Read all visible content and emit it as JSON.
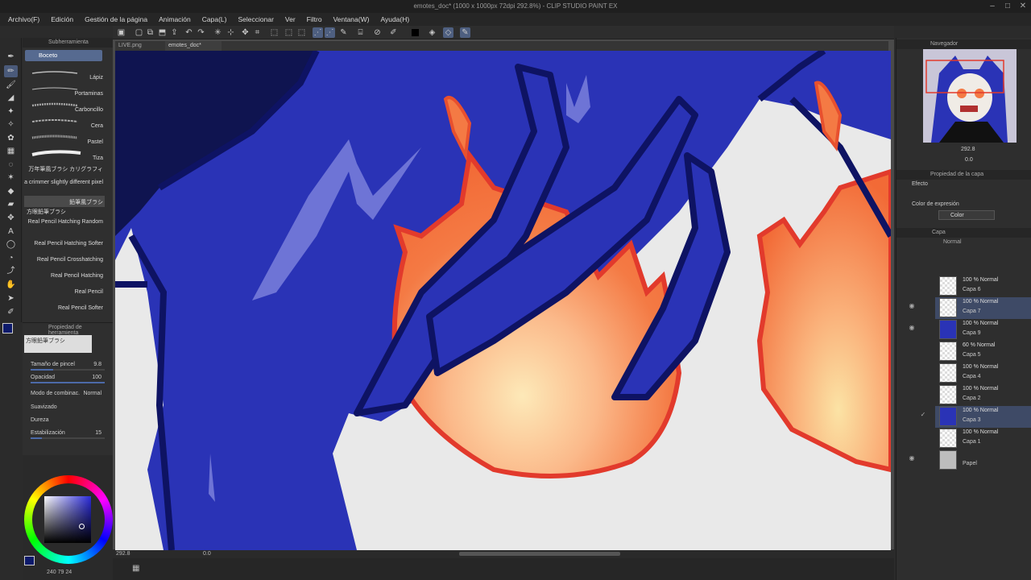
{
  "window": {
    "title": "emotes_doc* (1000 x 1000px 72dpi 292.8%) - CLIP STUDIO PAINT EX"
  },
  "menu": [
    "Archivo(F)",
    "Edición",
    "Gestión de la página",
    "Animación",
    "Capa(L)",
    "Seleccionar",
    "Ver",
    "Filtro",
    "Ventana(W)",
    "Ayuda(H)"
  ],
  "subtool": {
    "header": "Subherramienta",
    "group": "Boceto",
    "brushes": [
      "Lápiz",
      "Portaminas",
      "Carboncillo",
      "Cera",
      "Pastel",
      "Tiza",
      "万年筆風ブラシ カリグラフィ",
      "a crimmer slightly different pixel",
      "鉛筆風ブラシ",
      "方眼鉛筆ブラシ",
      "Real Pencil Hatching Random",
      "Real Pencil Hatching Softer",
      "Real Pencil Crosshatching",
      "Real Pencil Hatching",
      "Real Pencil",
      "Real Pencil Softer"
    ]
  },
  "tool_property": {
    "header": "Propiedad de herramienta",
    "preset": "方眼鉛筆ブラシ",
    "brush_size_label": "Tamaño de pincel",
    "brush_size": "9.8",
    "opacity_label": "Opacidad",
    "opacity": "100",
    "blend_label": "Modo de combinac.",
    "blend": "Normal",
    "smoothing_label": "Suavizado",
    "hardness_label": "Dureza",
    "stabilization_label": "Estabilización",
    "stabilization": "15"
  },
  "color": {
    "main": "#0d1a6b",
    "sub": "#ffffff",
    "readout": "240 79 24"
  },
  "tabs": [
    "LIVE.png",
    "emotes_doc*"
  ],
  "status": {
    "zoom": "292.8",
    "angle": "0.0"
  },
  "navigator": {
    "title": "Navegador",
    "zoom": "292.8",
    "rotation": "0.0"
  },
  "layer_property": {
    "title": "Propiedad de la capa",
    "effect_label": "Efecto",
    "expression_color_label": "Color de expresión",
    "expression_color": "Color"
  },
  "layers_panel": {
    "title": "Capa",
    "blend": "Normal",
    "layers": [
      {
        "mode": "100 % Normal",
        "name": "Capa 6"
      },
      {
        "mode": "100 % Normal",
        "name": "Capa 7"
      },
      {
        "mode": "100 % Normal",
        "name": "Capa 9"
      },
      {
        "mode": "60 % Normal",
        "name": "Capa 5"
      },
      {
        "mode": "100 % Normal",
        "name": "Capa 4"
      },
      {
        "mode": "100 % Normal",
        "name": "Capa 2"
      },
      {
        "mode": "100 % Normal",
        "name": "Capa 3"
      },
      {
        "mode": "100 % Normal",
        "name": "Capa 1"
      },
      {
        "mode": "",
        "name": "Papel"
      }
    ]
  },
  "palette": {
    "hair_dark": "#0e1363",
    "hair": "#2a33b6",
    "hair_highlight": "#6e74d6",
    "flame_outer": "#e23a2c",
    "flame_mid": "#f4703c",
    "flame_inner": "#fde9b8",
    "accent_ui": "#4e5f80"
  }
}
